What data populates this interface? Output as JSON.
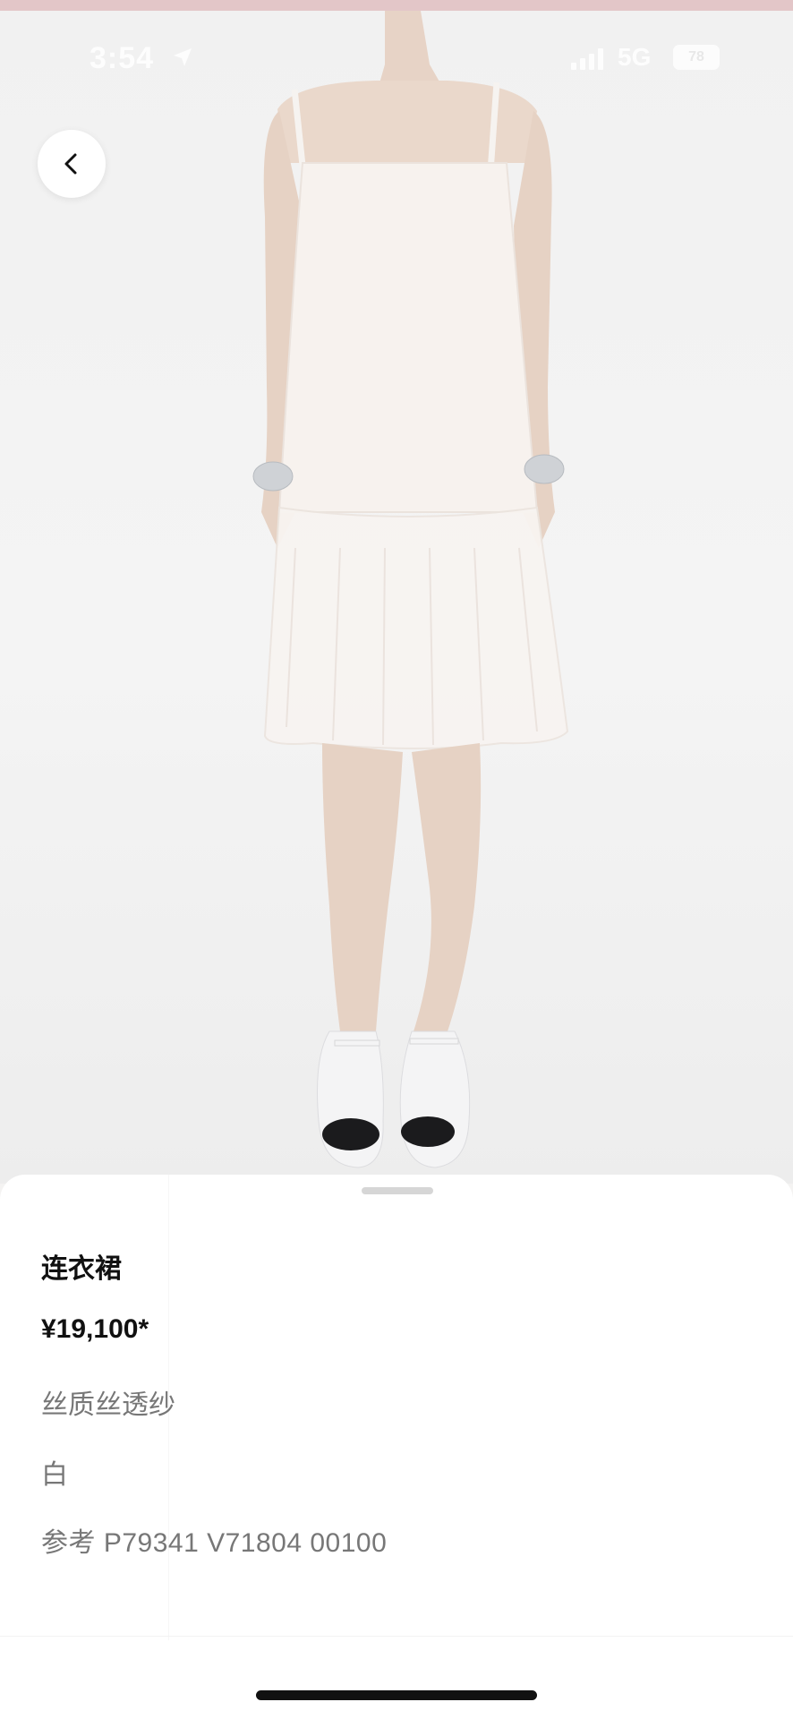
{
  "status_bar": {
    "time": "3:54",
    "network": "5G",
    "battery": "78"
  },
  "navigation": {
    "back_icon": "chevron-left-icon"
  },
  "product": {
    "name": "连衣裙",
    "price": "¥19,100*",
    "material": "丝质丝透纱",
    "color": "白",
    "reference": "参考 P79341 V71804 00100"
  },
  "colors": {
    "sheet_background": "#ffffff",
    "primary_text": "#111111",
    "secondary_text": "#777777",
    "photo_background": "#f2f2f2"
  }
}
